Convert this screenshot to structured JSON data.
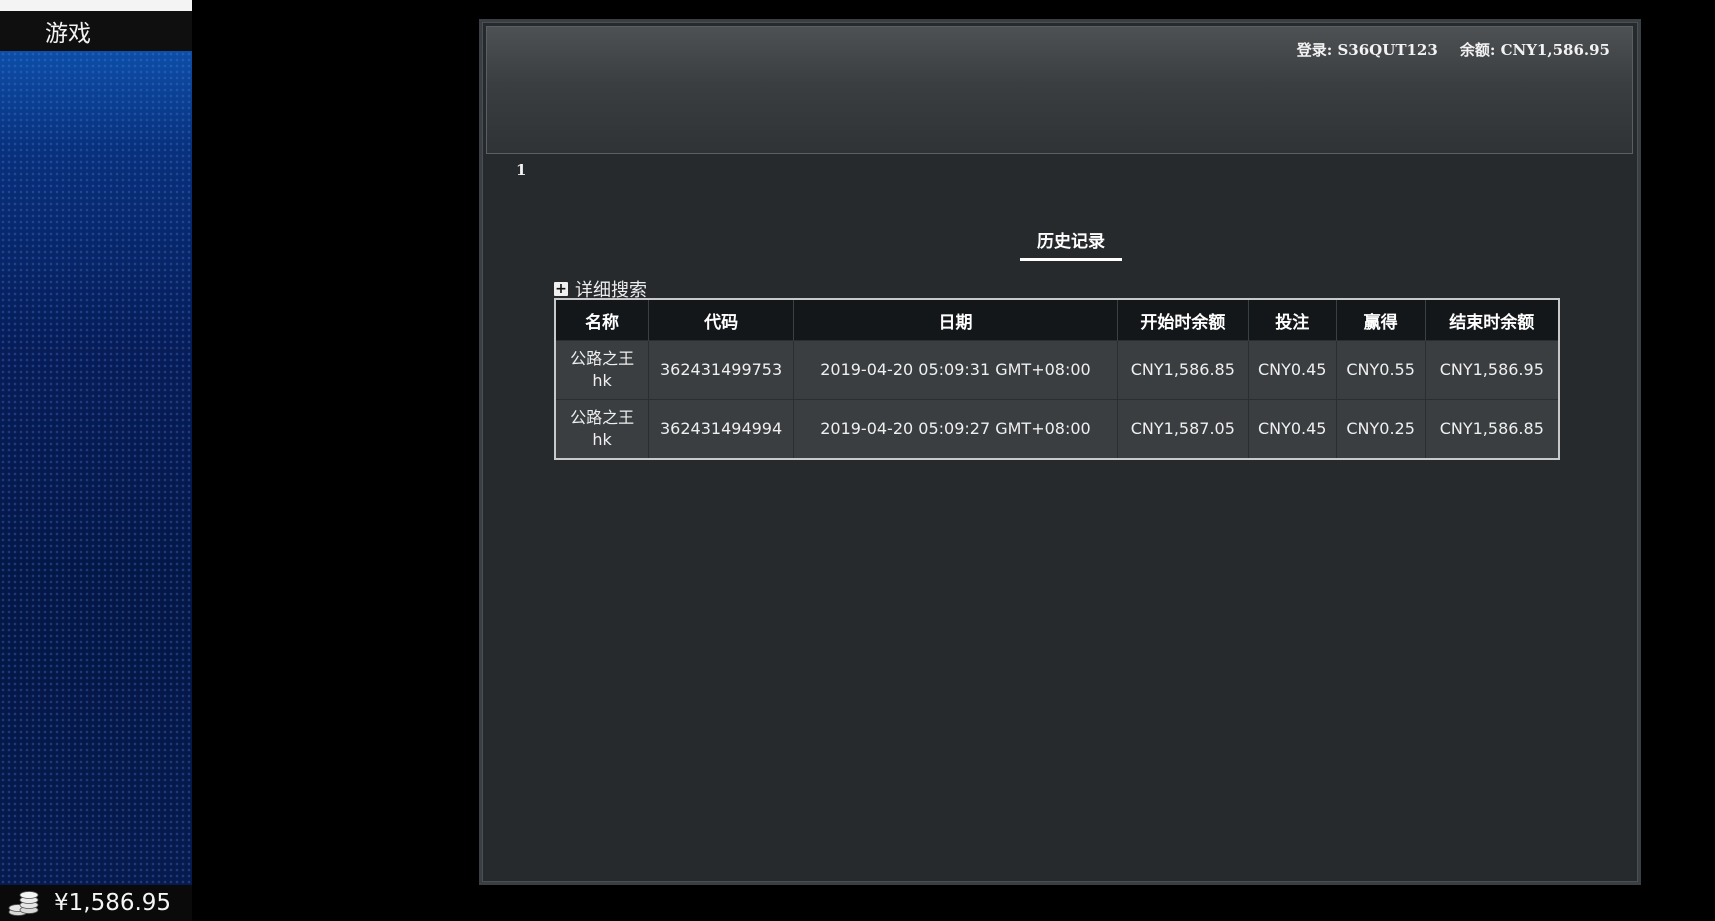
{
  "sidebar": {
    "title": "游戏",
    "balance": "¥1,586.95",
    "balance_icon": "coins-icon"
  },
  "header": {
    "login": "登录: S36QUT123",
    "balance": "余额: CNY1,586.95"
  },
  "page_number": "1",
  "history": {
    "title": "历史记录",
    "detail_search_label": "详细搜索",
    "detail_search_icon": "plus-icon",
    "columns": [
      "名称",
      "代码",
      "日期",
      "开始时余额",
      "投注",
      "赢得",
      "结束时余额"
    ],
    "rows": [
      {
        "name_line1": "公路之王",
        "name_line2": "hk",
        "code": "362431499753",
        "date": "2019-04-20 05:09:31 GMT+08:00",
        "start_balance": "CNY1,586.85",
        "bet": "CNY0.45",
        "win": "CNY0.55",
        "end_balance": "CNY1,586.95"
      },
      {
        "name_line1": "公路之王",
        "name_line2": "hk",
        "code": "362431494994",
        "date": "2019-04-20 05:09:27 GMT+08:00",
        "start_balance": "CNY1,587.05",
        "bet": "CNY0.45",
        "win": "CNY0.25",
        "end_balance": "CNY1,586.85"
      }
    ]
  }
}
